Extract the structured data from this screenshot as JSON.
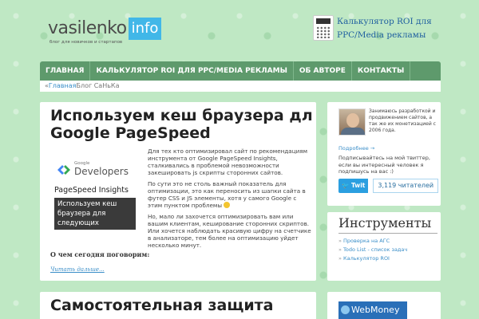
{
  "header": {
    "logo_main": "vasilenko",
    "logo_box": "info",
    "logo_tagline": "блог для новичков и стартапов",
    "roi_promo_line1": "Калькулятор ROI для",
    "roi_promo_line2": "PPC/Media рекламы"
  },
  "nav": {
    "items": [
      "ГЛАВНАЯ",
      "КАЛЬКУЛЯТОР ROI ДЛЯ PPC/MEDIA РЕКЛАМЫ",
      "ОБ АВТОРЕ",
      "КОНТАКТЫ"
    ]
  },
  "breadcrumb": {
    "prefix": "«",
    "home": "Главная",
    "current": "Блог СаНьКа"
  },
  "post": {
    "title_line1": "Используем кеш браузера дл",
    "title_line2": "Google PageSpeed",
    "image": {
      "google": "Google",
      "developers": "Developers",
      "psi": "PageSpeed Insights",
      "caption": "Используем кеш браузера для следующих ресурсов"
    },
    "paragraphs": [
      "Для тех кто оптимизировал сайт по рекомендациям инструмента от Google PageSpeed Insights, сталкивались в проблемой невозможности закешировать js скрипты сторонних сайтов.",
      "По сути это не столь важный показатель для оптимизации, это как переносить из шапки сайта в футер CSS и JS элементы, хотя у самого Google с этим пунктом проблемы",
      "Но, мало ли захочется оптимизировать вам или вашим клиентам, кеширование сторонних скриптов. Или хочется наблюдать красивую цифру на счетчике в анализаторе, тем более на оптимизацию уйдет несколько минут."
    ],
    "talk": "О чем сегодня поговорим:",
    "read_more": "Читать дальше..."
  },
  "post2": {
    "title": "Самостоятельная защита"
  },
  "author": {
    "bio": "Занимаюсь разработкой и продвижением сайтов, а так же их монетизацией с 2006 года.",
    "more": "Подробнее →",
    "subscribe": "Подписывайтесь на мой твиттер, если вы интересный человек я подпишусь на вас :)",
    "twitter_label": "Twit",
    "twitter_count": "3,119 читателей"
  },
  "tools": {
    "title": "Инструменты",
    "items": [
      "Проверка на АГС",
      "Todo List - список задач",
      "Калькулятор ROI"
    ]
  },
  "webmoney": {
    "label": "WebMoney"
  },
  "colors": {
    "background": "#bfe8c4",
    "nav": "#5e9a6c",
    "link": "#3a8ec8",
    "logo_box": "#41b7e8"
  }
}
